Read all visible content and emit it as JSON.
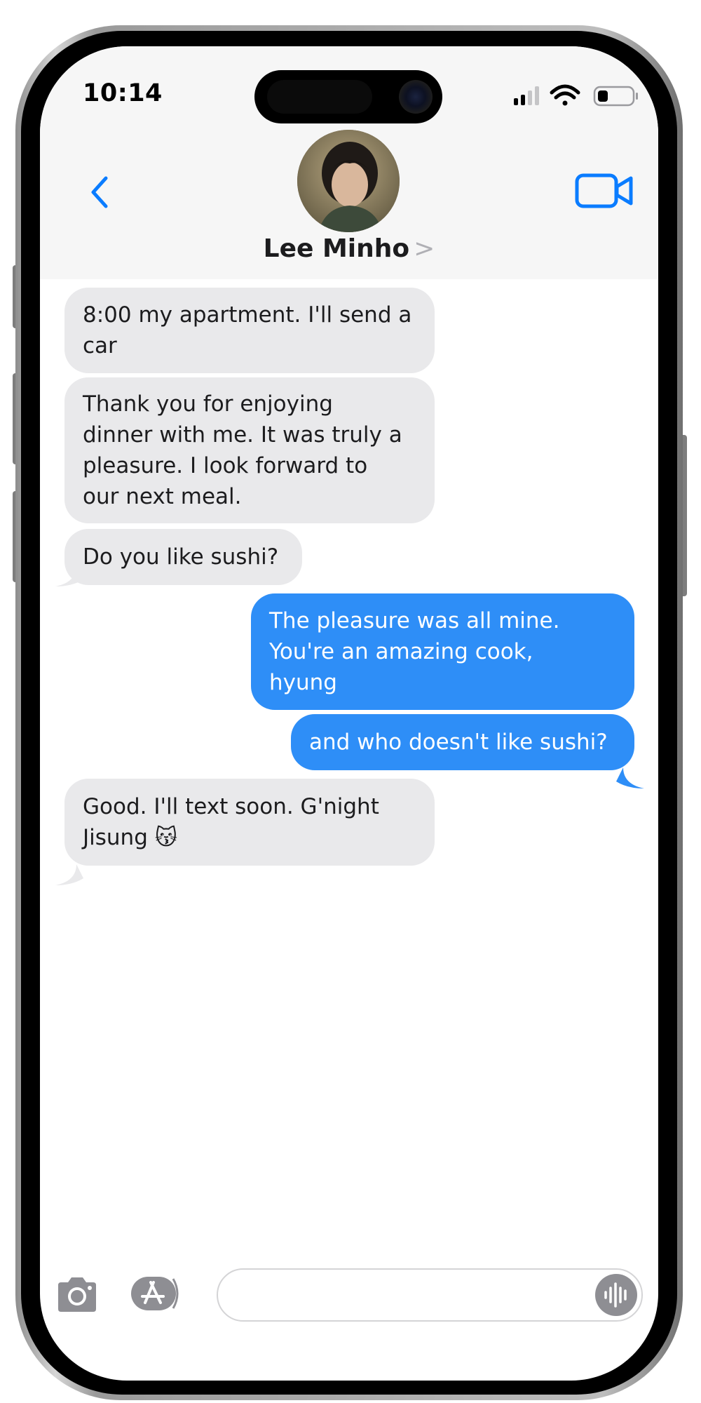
{
  "status_bar": {
    "time": "10:14"
  },
  "header": {
    "contact_name": "Lee Minho",
    "name_chevron": ">"
  },
  "messages": [
    {
      "direction": "incoming",
      "lines": [
        "8:00 my apartment. I'll send a",
        "car"
      ]
    },
    {
      "direction": "incoming",
      "lines": [
        "Thank you for enjoying",
        "dinner with me. It was truly a",
        "pleasure. I look forward to",
        "our next meal."
      ]
    },
    {
      "direction": "incoming",
      "lines": [
        "Do you like sushi?"
      ]
    },
    {
      "direction": "outgoing",
      "lines": [
        "The pleasure was all mine.",
        "You're an amazing cook,",
        "hyung"
      ]
    },
    {
      "direction": "outgoing",
      "lines": [
        "and who doesn't like sushi?"
      ]
    },
    {
      "direction": "incoming",
      "lines": [
        "Good. I'll text soon. G'night",
        "Jisung 😽"
      ]
    }
  ],
  "colors": {
    "accent": "#0a7cff",
    "incoming_bubble": "#e9e9eb",
    "outgoing_bubble": "#2e8ef7",
    "header_bg": "#f6f6f6"
  },
  "icons": {
    "back": "chevron-left-icon",
    "video": "video-camera-icon",
    "camera": "camera-icon",
    "apps": "app-store-icon",
    "audio": "waveform-icon"
  },
  "input": {
    "value": "",
    "placeholder": ""
  }
}
